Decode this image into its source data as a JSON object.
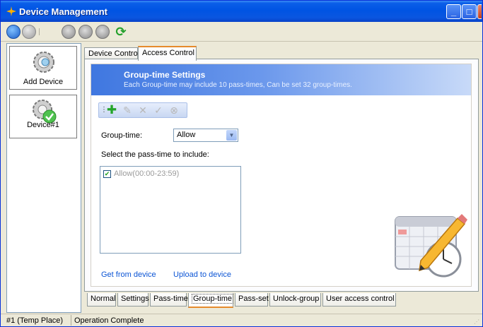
{
  "window": {
    "title": "Device Management"
  },
  "devices": [
    {
      "label": "Add Device"
    },
    {
      "label": "Device#1"
    }
  ],
  "top_tabs": [
    {
      "label": "Device Control"
    },
    {
      "label": "Access Control",
      "active": true
    }
  ],
  "banner": {
    "title": "Group-time Settings",
    "description": "Each Group-time may include 10 pass-times, Can be set 32 group-times."
  },
  "form": {
    "group_time_label": "Group-time:",
    "group_time_value": "Allow",
    "select_passtime_label": "Select the pass-time to include:",
    "pass_items": [
      {
        "label": "Allow(00:00-23:59)",
        "checked": true
      }
    ]
  },
  "links": {
    "get": "Get from device",
    "upload": "Upload to device"
  },
  "bottom_tabs": [
    {
      "label": "Normal"
    },
    {
      "label": "Settings"
    },
    {
      "label": "Pass-time"
    },
    {
      "label": "Group-time",
      "active": true
    },
    {
      "label": "Pass-set"
    },
    {
      "label": "Unlock-group"
    },
    {
      "label": "User access control"
    }
  ],
  "status": {
    "location": "#1 (Temp Place)",
    "message": "Operation Complete"
  }
}
